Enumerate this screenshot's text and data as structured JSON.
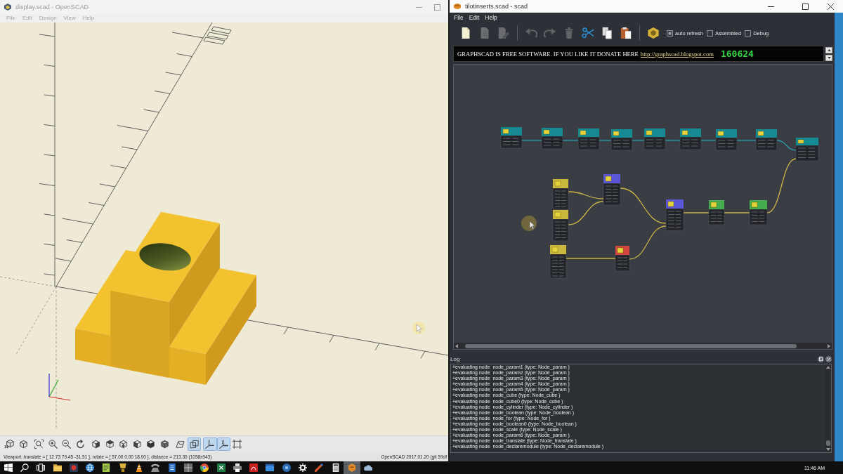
{
  "openscad": {
    "title": "display.scad - OpenSCAD",
    "menu": [
      "File",
      "Edit",
      "Design",
      "View",
      "Help"
    ],
    "view_toolbar": [
      [
        {
          "kind": "preview",
          "on": false
        },
        {
          "kind": "render",
          "on": false
        }
      ],
      [
        {
          "kind": "fit",
          "on": false
        },
        {
          "kind": "zoomin",
          "on": false
        },
        {
          "kind": "zoomout",
          "on": false
        },
        {
          "kind": "reset",
          "on": false
        }
      ],
      [
        {
          "kind": "right",
          "on": false
        },
        {
          "kind": "top",
          "on": false
        },
        {
          "kind": "bottom",
          "on": false
        },
        {
          "kind": "left",
          "on": false
        },
        {
          "kind": "front",
          "on": false
        },
        {
          "kind": "back",
          "on": false
        }
      ],
      [
        {
          "kind": "perspective",
          "on": false
        },
        {
          "kind": "orthogonal",
          "on": true
        }
      ],
      [
        {
          "kind": "axes",
          "on": true
        },
        {
          "kind": "scale",
          "on": true
        },
        {
          "kind": "edges",
          "on": false
        }
      ]
    ],
    "status": "Viewport: translate = [ 12.73 79.45 -31.51 ], rotate = [ 57.00 0.00 18.00 ], distance = 213.30 (1058x943)",
    "version": "OpenSCAD 2017.01.20 (git 59df"
  },
  "graphscad": {
    "title": "tilotinserts.scad - scad",
    "menu": [
      "File",
      "Edit",
      "Help"
    ],
    "toolbar": [
      [
        {
          "kind": "new",
          "disabled": false
        },
        {
          "kind": "open",
          "disabled": true
        },
        {
          "kind": "edit",
          "disabled": true
        }
      ],
      [
        {
          "kind": "undo",
          "disabled": true
        },
        {
          "kind": "redo",
          "disabled": true
        },
        {
          "kind": "delete",
          "disabled": true
        },
        {
          "kind": "cut",
          "disabled": false
        },
        {
          "kind": "copy",
          "disabled": false
        },
        {
          "kind": "paste",
          "disabled": false
        }
      ],
      [
        {
          "kind": "build",
          "disabled": false
        }
      ]
    ],
    "options": [
      {
        "label": "auto refresh",
        "checked": true
      },
      {
        "label": "Assembled",
        "checked": false
      },
      {
        "label": "Debug",
        "checked": false
      }
    ],
    "banner": {
      "message": "GRAPHSCAD IS FREE SOFTWARE. IF YOU LIKE IT DONATE HERE",
      "link": "http://graphscad.blogspot.com",
      "counter": "160624"
    },
    "graph": {
      "nodes": [
        {
          "color": "#168a93"
        },
        {
          "color": "#168a93"
        },
        {
          "color": "#168a93"
        },
        {
          "color": "#168a93"
        },
        {
          "color": "#168a93"
        },
        {
          "color": "#168a93"
        },
        {
          "color": "#168a93"
        },
        {
          "color": "#168a93"
        },
        {
          "color": "#168a93"
        },
        {
          "color": "#c9b83b"
        },
        {
          "color": "#c9b83b"
        },
        {
          "color": "#5b56d6"
        },
        {
          "color": "#5b56d6"
        },
        {
          "color": "#45ad4e"
        },
        {
          "color": "#45ad4e"
        },
        {
          "color": "#c9b83b"
        },
        {
          "color": "#d2463f"
        }
      ]
    },
    "log": {
      "title": "Log",
      "lines": [
        "+evaluating node  node_param1 (type: Node_param )",
        "+evaluating node  node_param2 (type: Node_param )",
        "+evaluating node  node_param3 (type: Node_param )",
        "+evaluating node  node_param4 (type: Node_param )",
        "+evaluating node  node_param5 (type: Node_param )",
        "+evaluating node  node_cube (type: Node_cube )",
        "+evaluating node  node_cube0 (type: Node_cube )",
        "+evaluating node  node_cylinder (type: Node_cylinder )",
        "+evaluating node  node_boolean (type: Node_boolean )",
        "+evaluating node  node_for (type: Node_for )",
        "+evaluating node  node_boolean0 (type: Node_boolean )",
        "+evaluating node  node_scale (type: Node_scale )",
        "+evaluating node  node_param6 (type: Node_param )",
        "+evaluating node  node_translate (type: Node_translate )",
        "+evaluating node  node_declaremodule (type: Node_declaremodule )"
      ]
    }
  },
  "taskbar": {
    "apps": [
      {
        "kind": "start",
        "selected": false
      },
      {
        "kind": "search",
        "selected": false
      },
      {
        "kind": "taskview",
        "selected": false
      },
      {
        "kind": "folder",
        "selected": false
      },
      {
        "kind": "record",
        "selected": false
      },
      {
        "kind": "globe",
        "selected": false
      },
      {
        "kind": "note",
        "selected": false
      },
      {
        "kind": "trophy",
        "selected": false
      },
      {
        "kind": "cone",
        "selected": false
      },
      {
        "kind": "phone",
        "selected": false
      },
      {
        "kind": "document",
        "selected": false
      },
      {
        "kind": "grid",
        "selected": false
      },
      {
        "kind": "ring",
        "selected": false
      },
      {
        "kind": "sheet",
        "selected": false
      },
      {
        "kind": "printer",
        "selected": false
      },
      {
        "kind": "pdf",
        "selected": false
      },
      {
        "kind": "window",
        "selected": false
      },
      {
        "kind": "disc",
        "selected": false
      },
      {
        "kind": "gear",
        "selected": false
      },
      {
        "kind": "pencil",
        "selected": false
      },
      {
        "kind": "calculator",
        "selected": false
      },
      {
        "kind": "hexagon",
        "selected": true
      },
      {
        "kind": "cloud",
        "selected": false
      }
    ],
    "clock": "11:46 AM"
  }
}
